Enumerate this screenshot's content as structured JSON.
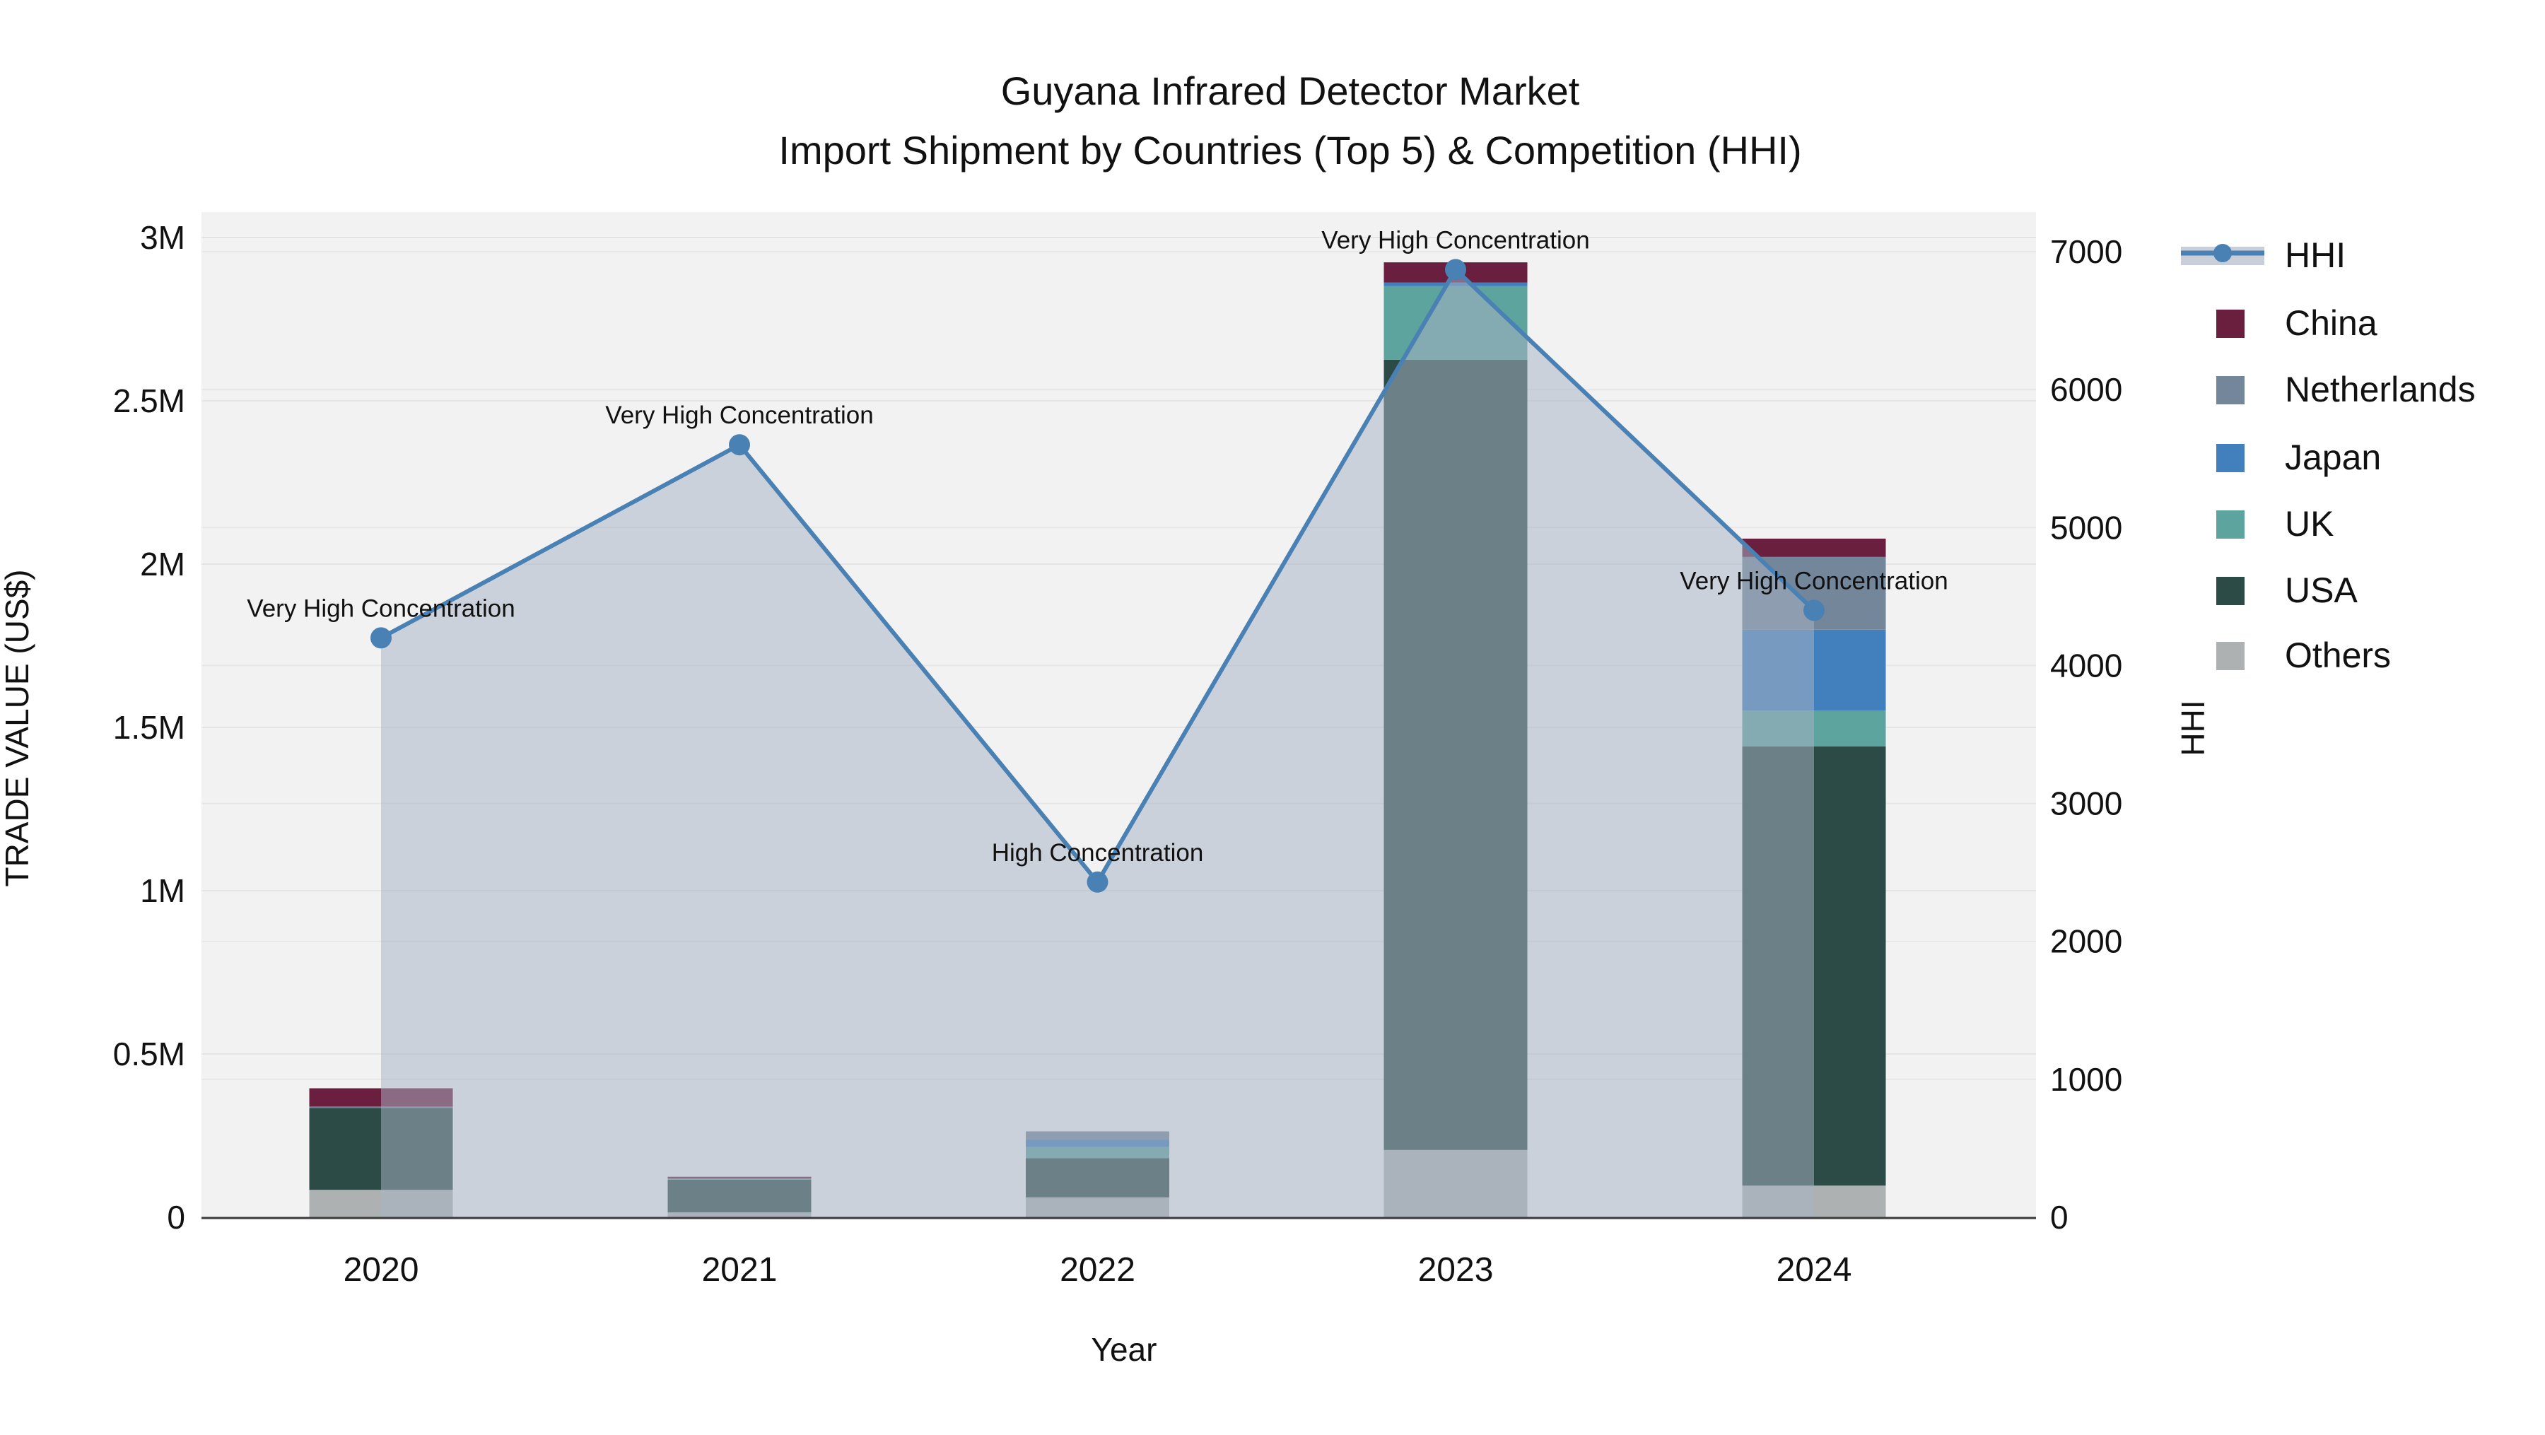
{
  "title": {
    "line1": "Guyana Infrared Detector Market",
    "line2": "Import Shipment by Countries (Top 5) & Competition (HHI)"
  },
  "axes": {
    "x": {
      "title": "Year",
      "categories": [
        "2020",
        "2021",
        "2022",
        "2023",
        "2024"
      ]
    },
    "y_left": {
      "title": "TRADE VALUE (US$)",
      "tick_labels": [
        "0",
        "0.5M",
        "1M",
        "1.5M",
        "2M",
        "2.5M",
        "3M"
      ],
      "tick_values": [
        0,
        500000,
        1000000,
        1500000,
        2000000,
        2500000,
        3000000
      ],
      "max": 3000000
    },
    "y_right": {
      "title": "HHI",
      "tick_labels": [
        "0",
        "1000",
        "2000",
        "3000",
        "4000",
        "5000",
        "6000",
        "7000"
      ],
      "tick_values": [
        0,
        1000,
        2000,
        3000,
        4000,
        5000,
        6000,
        7000
      ],
      "max": 7000
    }
  },
  "legend": [
    {
      "label": "HHI",
      "type": "line",
      "color": "#4a81b4",
      "band_color": "#c9cfd9"
    },
    {
      "label": "China",
      "type": "square",
      "color": "#6b1f3e"
    },
    {
      "label": "Netherlands",
      "type": "square",
      "color": "#74879a"
    },
    {
      "label": "Japan",
      "type": "square",
      "color": "#4280bd"
    },
    {
      "label": "UK",
      "type": "square",
      "color": "#5da49e"
    },
    {
      "label": "USA",
      "type": "square",
      "color": "#2d4b46"
    },
    {
      "label": "Others",
      "type": "square",
      "color": "#aeb1b1"
    }
  ],
  "chart_data": {
    "type": "bar+line",
    "title": "Guyana Infrared Detector Market — Import Shipment by Countries (Top 5) & Competition (HHI)",
    "categories": [
      "2020",
      "2021",
      "2022",
      "2023",
      "2024"
    ],
    "xlabel": "Year",
    "ylabel_left": "TRADE VALUE (US$)",
    "ylabel_right": "HHI",
    "ylim_left": [
      0,
      3000000
    ],
    "ylim_right": [
      0,
      7000
    ],
    "grid": true,
    "legend_position": "right",
    "series": [
      {
        "name": "China",
        "color": "#6b1f3e",
        "values": [
          56000,
          5000,
          0,
          62000,
          56000
        ]
      },
      {
        "name": "Netherlands",
        "color": "#74879a",
        "values": [
          4000,
          0,
          26000,
          0,
          223000
        ]
      },
      {
        "name": "Japan",
        "color": "#4280bd",
        "values": [
          0,
          0,
          22000,
          11000,
          247000
        ]
      },
      {
        "name": "UK",
        "color": "#5da49e",
        "values": [
          0,
          4000,
          34000,
          225000,
          110000
        ]
      },
      {
        "name": "USA",
        "color": "#2d4b46",
        "values": [
          251000,
          100000,
          120000,
          2420000,
          1345000
        ]
      },
      {
        "name": "Others",
        "color": "#aeb1b1",
        "values": [
          84000,
          15000,
          61000,
          206000,
          97000
        ]
      }
    ],
    "bar_totals": [
      395000,
      124000,
      263000,
      2924000,
      2078000
    ],
    "line_series": {
      "name": "HHI",
      "color": "#4a81b4",
      "fill_color": "rgba(167,178,196,0.52)",
      "values": [
        4200,
        5600,
        2430,
        6870,
        4400
      ]
    },
    "annotations": [
      {
        "year": "2020",
        "text": "Very High Concentration"
      },
      {
        "year": "2021",
        "text": "Very High Concentration"
      },
      {
        "year": "2022",
        "text": "High Concentration"
      },
      {
        "year": "2023",
        "text": "Very High Concentration"
      },
      {
        "year": "2024",
        "text": "Very High Concentration"
      }
    ]
  }
}
